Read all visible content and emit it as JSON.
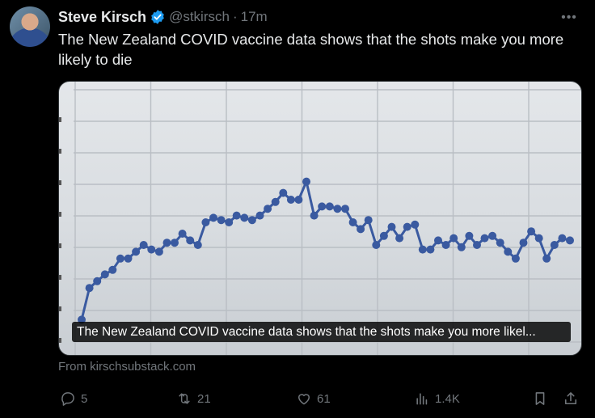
{
  "tweet": {
    "author_name": "Steve Kirsch",
    "handle": "@stkirsch",
    "separator": "·",
    "time": "17m",
    "text": "The New Zealand COVID vaccine data shows that the shots make you more likely to die",
    "media_caption": "The New Zealand COVID vaccine data shows that the shots make you more likel...",
    "source": "From kirschsubstack.com"
  },
  "actions": {
    "replies": "5",
    "reposts": "21",
    "likes": "61",
    "views": "1.4K"
  },
  "colors": {
    "background": "#000000",
    "text": "#e7e9ea",
    "muted": "#71767b",
    "verified": "#1d9bf0",
    "chart_line": "#3a5aa0"
  },
  "chart_data": {
    "type": "line",
    "title": "",
    "xlabel": "",
    "ylabel": "",
    "grid": true,
    "ylim": [
      0,
      10
    ],
    "values": [
      0.2,
      1.6,
      1.9,
      2.2,
      2.4,
      2.9,
      2.9,
      3.2,
      3.5,
      3.3,
      3.2,
      3.6,
      3.6,
      4.0,
      3.7,
      3.5,
      4.5,
      4.7,
      4.6,
      4.5,
      4.8,
      4.7,
      4.6,
      4.8,
      5.1,
      5.4,
      5.8,
      5.5,
      5.5,
      6.3,
      4.8,
      5.2,
      5.2,
      5.1,
      5.1,
      4.5,
      4.2,
      4.6,
      3.5,
      3.9,
      4.3,
      3.8,
      4.3,
      4.4,
      3.3,
      3.3,
      3.7,
      3.5,
      3.8,
      3.4,
      3.9,
      3.5,
      3.8,
      3.9,
      3.6,
      3.2,
      2.9,
      3.6,
      4.1,
      3.8,
      2.9,
      3.5,
      3.8,
      3.7
    ],
    "icons": [
      "verified-badge",
      "more-icon",
      "reply-icon",
      "repost-icon",
      "like-icon",
      "views-icon",
      "bookmark-icon",
      "share-icon"
    ]
  }
}
